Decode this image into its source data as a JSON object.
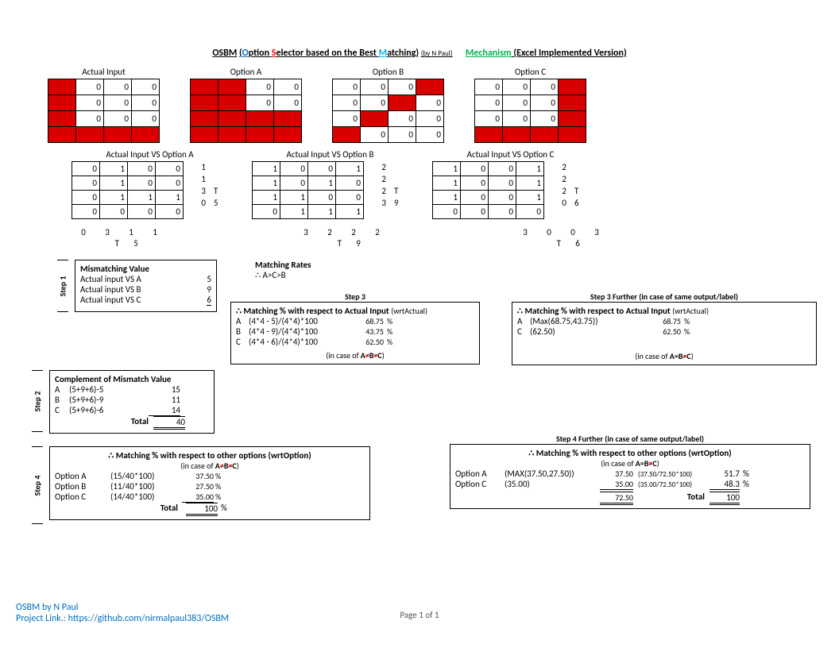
{
  "title": {
    "osbm": "OSBM",
    "expansion_pre": " (",
    "o": "O",
    "ption": "ption ",
    "s": "S",
    "elector": "elector based on the ",
    "b": "B",
    "est": "est ",
    "m": "M",
    "atching": "atching)",
    "by": " (by N Paul)",
    "mech": "Mechanism",
    "exc": " (Excel Implemented Version)"
  },
  "mat_titles": {
    "actual": "Actual Input",
    "a": "Option A",
    "b": "Option B",
    "c": "Option C"
  },
  "matrices": {
    "actual": [
      [
        1,
        0,
        0,
        0
      ],
      [
        1,
        0,
        0,
        0
      ],
      [
        1,
        0,
        0,
        0
      ],
      [
        1,
        1,
        1,
        1
      ]
    ],
    "a": [
      [
        1,
        1,
        0,
        0
      ],
      [
        1,
        1,
        0,
        0
      ],
      [
        1,
        1,
        1,
        1
      ],
      [
        1,
        1,
        1,
        1
      ]
    ],
    "b": [
      [
        0,
        0,
        0,
        1
      ],
      [
        0,
        0,
        1,
        0
      ],
      [
        0,
        1,
        0,
        0
      ],
      [
        1,
        0,
        0,
        0
      ]
    ],
    "c": [
      [
        0,
        0,
        0,
        1
      ],
      [
        0,
        0,
        0,
        1
      ],
      [
        0,
        0,
        0,
        1
      ],
      [
        1,
        1,
        1,
        1
      ]
    ]
  },
  "vs_titles": {
    "a": "Actual Input VS Option A",
    "b": "Actual Input VS Option B",
    "c": "Actual Input VS Option C"
  },
  "vs": {
    "a": {
      "grid": [
        [
          0,
          1,
          0,
          0
        ],
        [
          0,
          1,
          0,
          0
        ],
        [
          0,
          1,
          1,
          1
        ],
        [
          0,
          0,
          0,
          0
        ]
      ],
      "row_sum": [
        1,
        1,
        3,
        0
      ],
      "col_sum": [
        0,
        3,
        1,
        1
      ],
      "total": 5
    },
    "b": {
      "grid": [
        [
          1,
          0,
          0,
          1
        ],
        [
          1,
          0,
          1,
          0
        ],
        [
          1,
          1,
          0,
          0
        ],
        [
          0,
          1,
          1,
          1
        ]
      ],
      "row_sum": [
        2,
        2,
        2,
        3
      ],
      "col_sum": [
        3,
        2,
        2,
        2
      ],
      "total": 9
    },
    "c": {
      "grid": [
        [
          1,
          0,
          0,
          1
        ],
        [
          1,
          0,
          0,
          1
        ],
        [
          1,
          0,
          0,
          1
        ],
        [
          0,
          0,
          0,
          0
        ]
      ],
      "row_sum": [
        2,
        2,
        2,
        0
      ],
      "col_sum": [
        3,
        0,
        0,
        3
      ],
      "total": 6
    }
  },
  "T": "T",
  "step1": {
    "title": "Mismatching Value",
    "label": "Step 1",
    "rows": [
      {
        "name": "Actual input VS A",
        "val": "5"
      },
      {
        "name": "Actual input VS B",
        "val": "9"
      },
      {
        "name": "Actual input VS C",
        "val": "6"
      }
    ]
  },
  "rates": {
    "title": "Matching Rates",
    "expr": "∴   A>C>B"
  },
  "step2": {
    "title": "Complement of Mismatch Value",
    "label": "Step 2",
    "rows": [
      {
        "k": "A",
        "expr": "(5+9+6)-5",
        "val": "15"
      },
      {
        "k": "B",
        "expr": "(5+9+6)-9",
        "val": "11"
      },
      {
        "k": "C",
        "expr": "(5+9+6)-6",
        "val": "14"
      }
    ],
    "total_lbl": "Total",
    "total": "40"
  },
  "step3": {
    "hdr": "Step 3",
    "title": "∴ Matching % with respect to Actual Input",
    "sub": "(wrtActual)",
    "rows": [
      {
        "k": "A",
        "expr": "(4*4 - 5)/(4*4)*100",
        "val": "68.75",
        "u": "%"
      },
      {
        "k": "B",
        "expr": "(4*4 - 9)/(4*4)*100",
        "val": "43.75",
        "u": "%"
      },
      {
        "k": "C",
        "expr": "(4*4 - 6)/(4*4)*100",
        "val": "62.50",
        "u": "%"
      }
    ],
    "case": "(in case of A≠B≠C)"
  },
  "step3f": {
    "hdr": "Step 3 Further (in case of same output/label)",
    "title": "∴ Matching % with respect to Actual Input",
    "sub": "(wrtActual)",
    "rows": [
      {
        "k": "A",
        "expr": "(Max(68.75,43.75))",
        "val": "68.75",
        "u": "%"
      },
      {
        "k": "C",
        "expr": "(62.50)",
        "val": "62.50",
        "u": "%"
      }
    ],
    "case": "(in case of A=B≠C)"
  },
  "step4": {
    "label": "Step 4",
    "title": "∴ Matching % with respect to other options (wrtOption)",
    "case": "(in case of A≠B≠C)",
    "rows": [
      {
        "k": "Option A",
        "expr": "(15/40*100)",
        "val": "37.50",
        "u": "%"
      },
      {
        "k": "Option B",
        "expr": "(11/40*100)",
        "val": "27.50",
        "u": "%"
      },
      {
        "k": "Option C",
        "expr": "(14/40*100)",
        "val": "35.00",
        "u": "%"
      }
    ],
    "total_lbl": "Total",
    "total": "100",
    "u": "%"
  },
  "step4f": {
    "hdr": "Step 4 Further (in case of same output/label)",
    "title": "∴ Matching % with respect to other options (wrtOption)",
    "case": "(in case of A=B≠C)",
    "rows": [
      {
        "k": "Option A",
        "expr": "(MAX(37.50,27.50))",
        "mid": "37.50",
        "detail": "(37.50/72.50*100)",
        "val": "51.7",
        "u": "%"
      },
      {
        "k": "Option C",
        "expr": "(35.00)",
        "mid": "35.00",
        "detail": "(35.00/72.50*100)",
        "val": "48.3",
        "u": "%"
      }
    ],
    "sum": "72.50",
    "total_lbl": "Total",
    "total": "100"
  },
  "footer": {
    "line1": "OSBM by N Paul",
    "line2": "Project Link.: https://github.com/nirmalpaul383/OSBM",
    "page": "Page 1 of 1"
  }
}
